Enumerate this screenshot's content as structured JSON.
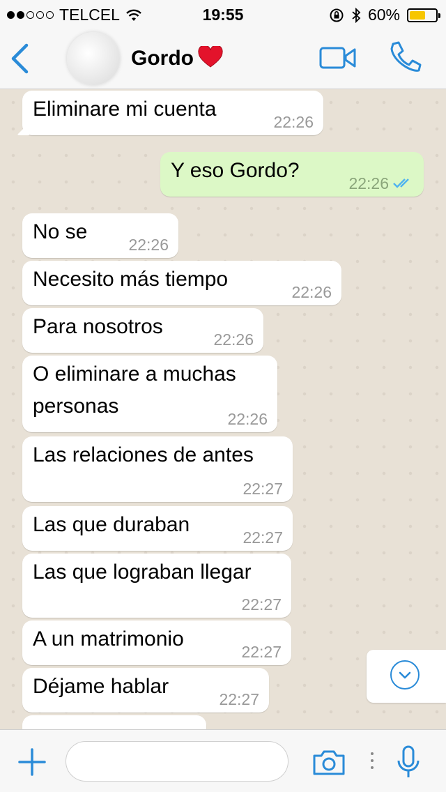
{
  "status_bar": {
    "carrier": "TELCEL",
    "time": "19:55",
    "battery_percent": "60%",
    "battery_level": 0.6,
    "signal_bars": 2
  },
  "header": {
    "contact_name": "Gordo",
    "emoji": "❤️"
  },
  "messages": [
    {
      "direction": "in",
      "text": "Eliminare mi cuenta",
      "time": "22:26"
    },
    {
      "direction": "out",
      "text": "Y eso Gordo?",
      "time": "22:26",
      "status": "read"
    },
    {
      "direction": "in",
      "text": "No se",
      "time": "22:26"
    },
    {
      "direction": "in",
      "text": "Necesito más tiempo",
      "time": "22:26"
    },
    {
      "direction": "in",
      "text": "Para nosotros",
      "time": "22:26"
    },
    {
      "direction": "in",
      "text": "O eliminare a muchas personas",
      "time": "22:26"
    },
    {
      "direction": "in",
      "text": "Las relaciones de antes",
      "time": "22:27"
    },
    {
      "direction": "in",
      "text": "Las que duraban",
      "time": "22:27"
    },
    {
      "direction": "in",
      "text": "Las que lograban llegar",
      "time": "22:27"
    },
    {
      "direction": "in",
      "text": "A un matrimonio",
      "time": "22:27"
    },
    {
      "direction": "in",
      "text": "Déjame hablar",
      "time": "22:27"
    }
  ],
  "input": {
    "value": "",
    "placeholder": ""
  },
  "icons": {
    "back": "chevron-left-icon",
    "video": "video-camera-icon",
    "call": "phone-icon",
    "attach": "plus-icon",
    "camera": "camera-icon",
    "mic": "microphone-icon",
    "scroll": "chevron-down-icon"
  },
  "colors": {
    "accent": "#2a8bd8",
    "outgoing_bubble": "#dcf8c6",
    "incoming_bubble": "#ffffff",
    "read_ticks": "#4fb3f0",
    "battery": "#f7c600"
  }
}
